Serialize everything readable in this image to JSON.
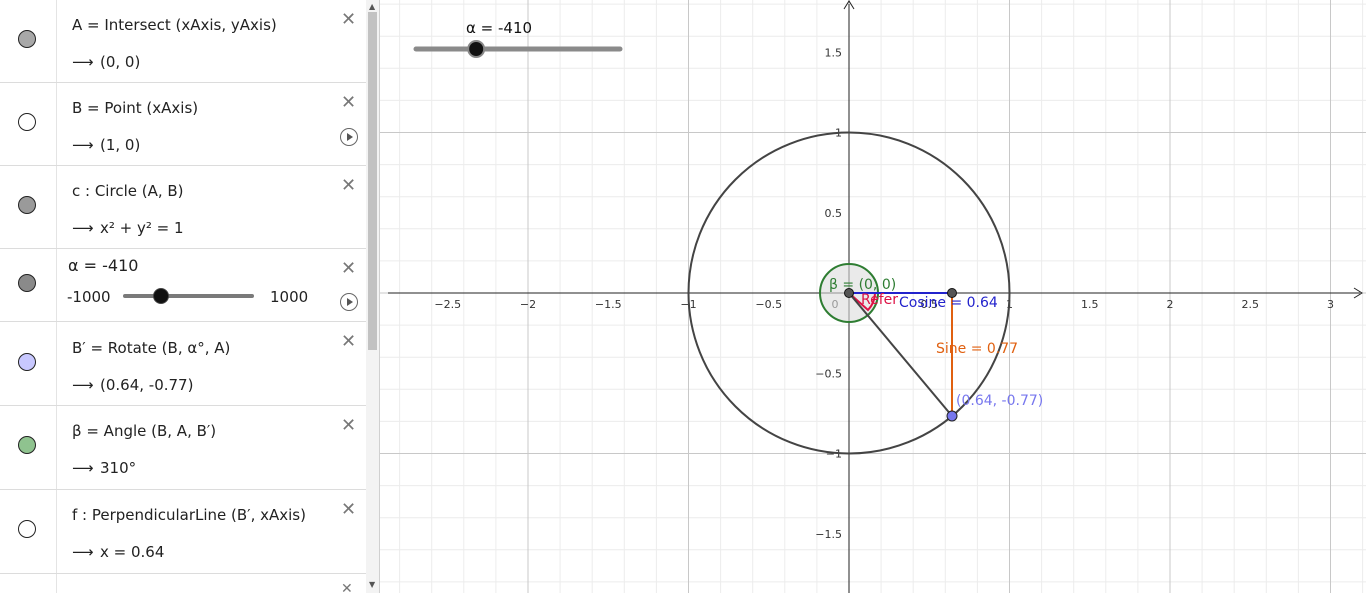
{
  "algebra": {
    "rows": [
      {
        "definition": "A = Intersect (xAxis, yAxis)",
        "value": "(0,  0)",
        "color": "#a8a8a8"
      },
      {
        "definition": "B = Point (xAxis)",
        "value": "(1,  0)",
        "color": "#ffffff"
      },
      {
        "definition": "c : Circle (A, B)",
        "value": "x² + y² = 1",
        "color": "#9a9a9a"
      },
      {
        "definition": "α = -410",
        "slider_min": "-1000",
        "slider_max": "1000",
        "color": "#8a8a8a"
      },
      {
        "definition": "B′ = Rotate (B, α°, A)",
        "value": "(0.64,  -0.77)",
        "color": "#c8c8ff"
      },
      {
        "definition": "β = Angle (B, A, B′)",
        "value": "310°",
        "color": "#8fc38f"
      },
      {
        "definition": "f : PerpendicularLine (B′, xAxis)",
        "value": "x  =  0.64",
        "color": "#ffffff"
      }
    ],
    "arrow": "⟶",
    "delete": "✕"
  },
  "graphics": {
    "slider_label": "α = -410",
    "slider_value": -410,
    "slider_min": -1000,
    "slider_max": 1000,
    "labels": {
      "beta": "β = (0, 0)",
      "reference": "Refer",
      "cosine": "Cosine = 0.64",
      "sine": "Sine = 0.77",
      "point": "(0.64, -0.77)"
    },
    "colors": {
      "circle": "#444444",
      "beta": "#2e7d32",
      "cosine": "#2222cc",
      "sine": "#e06010",
      "reference": "#dd1144",
      "point": "#7777ee"
    },
    "x_ticks": [
      "−2.5",
      "−2",
      "−1.5",
      "−1",
      "−0.5",
      "0",
      "0.5",
      "1",
      "1.5",
      "2",
      "2.5",
      "3"
    ],
    "y_ticks": [
      "1.5",
      "1",
      "0.5",
      "−0.5",
      "−1",
      "−1.5"
    ]
  }
}
